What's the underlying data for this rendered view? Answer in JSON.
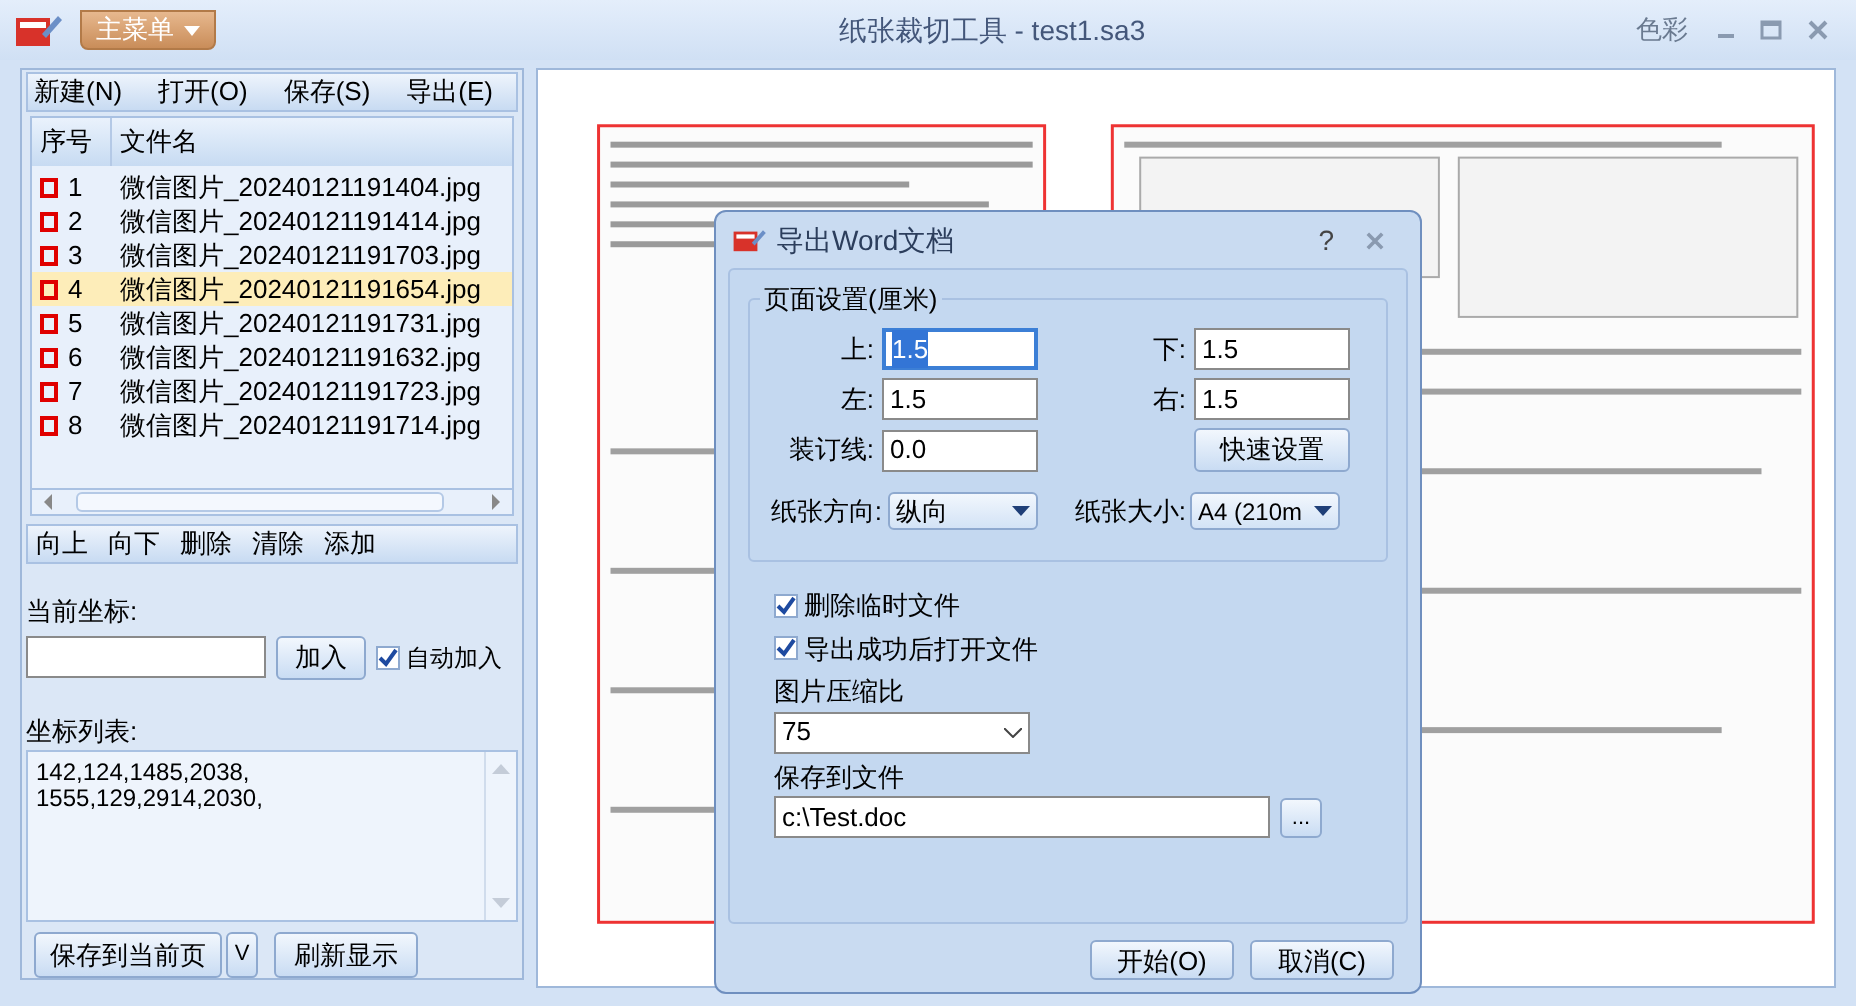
{
  "window": {
    "title": "纸张裁切工具 - test1.sa3",
    "menu_button": "主菜单",
    "theme": "色彩"
  },
  "toolbar": [
    "新建(N)",
    "打开(O)",
    "保存(S)",
    "导出(E)"
  ],
  "file_list": {
    "columns": [
      "序号",
      "文件名"
    ],
    "rows": [
      {
        "number": "1",
        "name": "微信图片_20240121191404.jpg",
        "selected": false
      },
      {
        "number": "2",
        "name": "微信图片_20240121191414.jpg",
        "selected": false
      },
      {
        "number": "3",
        "name": "微信图片_20240121191703.jpg",
        "selected": false
      },
      {
        "number": "4",
        "name": "微信图片_20240121191654.jpg",
        "selected": true
      },
      {
        "number": "5",
        "name": "微信图片_20240121191731.jpg",
        "selected": false
      },
      {
        "number": "6",
        "name": "微信图片_20240121191632.jpg",
        "selected": false
      },
      {
        "number": "7",
        "name": "微信图片_20240121191723.jpg",
        "selected": false
      },
      {
        "number": "8",
        "name": "微信图片_20240121191714.jpg",
        "selected": false
      }
    ]
  },
  "list_actions": [
    "向上",
    "向下",
    "删除",
    "清除",
    "添加"
  ],
  "coordinate": {
    "label": "当前坐标:",
    "add_button": "加入",
    "auto_add": {
      "label": "自动加入",
      "checked": true
    }
  },
  "coordinate_list": {
    "label": "坐标列表:",
    "lines": [
      "142,124,1485,2038,",
      "1555,129,2914,2030,"
    ]
  },
  "bottom_buttons": [
    "保存到当前页",
    "V",
    "刷新显示"
  ],
  "preview": {
    "kind": "picture"
  },
  "dialog": {
    "title": "导出Word文档",
    "help": "?",
    "group": "页面设置(厘米)",
    "margins": [
      {
        "label": "上:",
        "value": "1.5",
        "focused": true
      },
      {
        "label": "下:",
        "value": "1.5",
        "focused": false
      },
      {
        "label": "左:",
        "value": "1.5",
        "focused": false
      },
      {
        "label": "右:",
        "value": "1.5",
        "focused": false
      },
      {
        "label": "装订线:",
        "value": "0.0",
        "focused": false
      }
    ],
    "quick_button": "快速设置",
    "orientation": {
      "label": "纸张方向:",
      "value": "纵向"
    },
    "paper_size": {
      "label": "纸张大小:",
      "value": "A4 (210m"
    },
    "options": [
      {
        "label": "删除临时文件",
        "checked": true
      },
      {
        "label": "导出成功后打开文件",
        "checked": true
      }
    ],
    "compression": {
      "label": "图片压缩比",
      "value": "75"
    },
    "save_file": {
      "label": "保存到文件",
      "value": "c:\\Test.doc",
      "browse": "..."
    },
    "buttons": [
      "开始(O)",
      "取消(C)"
    ]
  }
}
